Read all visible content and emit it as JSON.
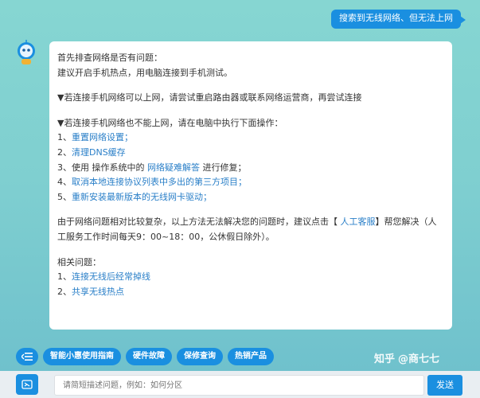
{
  "user_message": "搜索到无线网络、但无法上网",
  "bot_reply": {
    "intro1": "首先排查网络是否有问题：",
    "intro2": "建议开启手机热点，用电脑连接到手机测试。",
    "case1": "▼若连接手机网络可以上网，请尝试重启路由器或联系网络运营商，再尝试连接",
    "case2": "▼若连接手机网络也不能上网，请在电脑中执行下面操作：",
    "steps": [
      {
        "num": "1、",
        "pre": "",
        "link": "重置网络设置；",
        "post": ""
      },
      {
        "num": "2、",
        "pre": "",
        "link": "清理DNS缓存",
        "post": ""
      },
      {
        "num": "3、",
        "pre": "使用 操作系统中的 ",
        "link": "网络疑难解答",
        "post": " 进行修复；"
      },
      {
        "num": "4、",
        "pre": "",
        "link": "取消本地连接协议列表中多出的第三方项目；",
        "post": ""
      },
      {
        "num": "5、",
        "pre": "",
        "link": "重新安装最新版本的无线网卡驱动；",
        "post": ""
      }
    ],
    "complex_pre": "由于网络问题相对比较复杂，以上方法无法解决您的问题时，建议点击【 ",
    "complex_link": "人工客服",
    "complex_post": "】帮您解决（人",
    "complex_line2": "工服务工作时间每天9：00~18：00，公休假日除外）。",
    "related_title": "相关问题：",
    "related": [
      {
        "num": "1、",
        "label": "连接无线后经常掉线"
      },
      {
        "num": "2、",
        "label": "共享无线热点"
      }
    ]
  },
  "quick_actions": [
    "智能小惠使用指南",
    "硬件故障",
    "保修查询",
    "热销产品"
  ],
  "input": {
    "placeholder": "请简短描述问题，例如：如何分区"
  },
  "send_label": "发送",
  "watermark": {
    "logo": "知乎",
    "author": "@商七七"
  },
  "colors": {
    "accent": "#1a8fe0",
    "link": "#2a7fc8"
  },
  "icons": {
    "menu": "menu-collapse-icon",
    "keyboard": "keyboard-icon",
    "avatar": "robot-avatar-icon"
  }
}
